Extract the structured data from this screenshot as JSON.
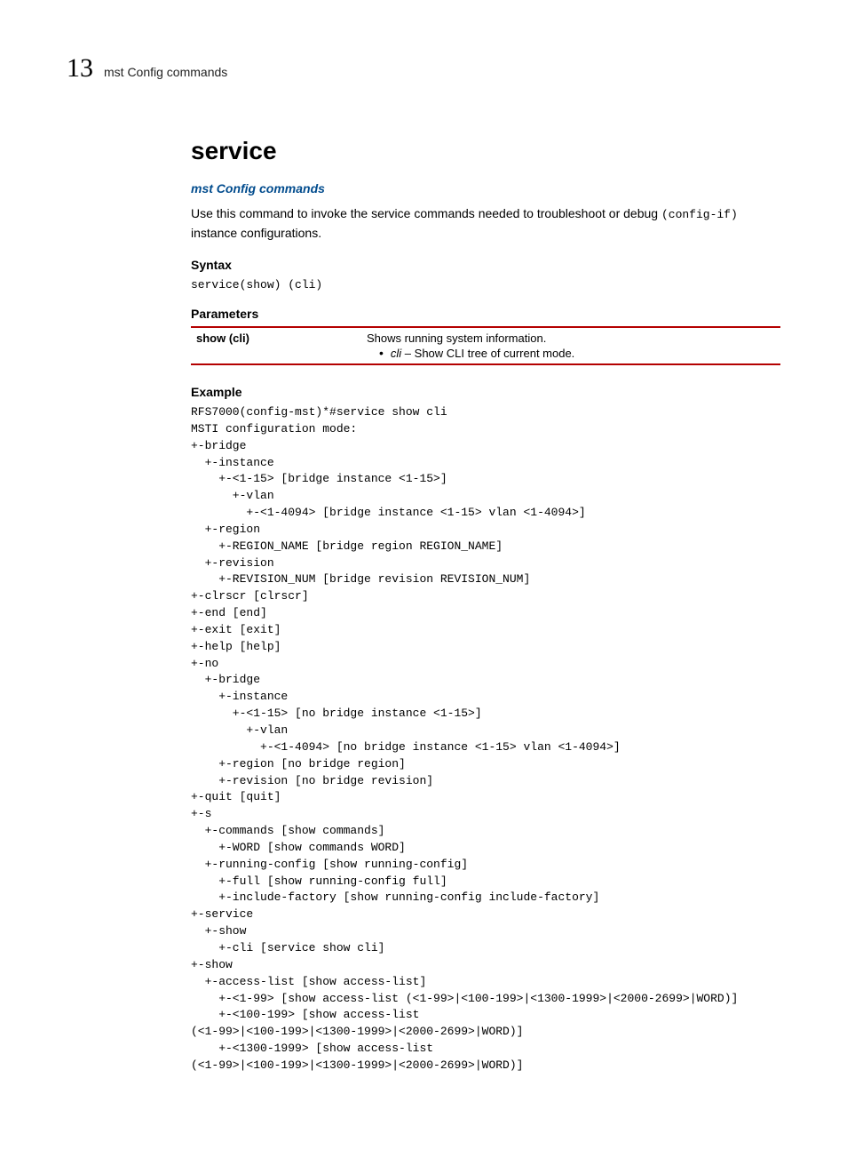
{
  "header": {
    "chapter_number": "13",
    "chapter_name": "mst Config commands"
  },
  "title": "service",
  "breadcrumb_link": "mst Config commands",
  "intro_before_code": "Use this command to invoke the service commands needed to troubleshoot or debug ",
  "intro_code": "(config-if)",
  "intro_after_code": " instance configurations.",
  "syntax": {
    "heading": "Syntax",
    "code": "service(show) (cli)"
  },
  "parameters": {
    "heading": "Parameters",
    "row": {
      "name": "show (cli)",
      "desc_line1": "Shows running system information.",
      "bullet_keyword": "cli",
      "bullet_sep": " – ",
      "bullet_text": "Show CLI tree of current mode."
    }
  },
  "example": {
    "heading": "Example",
    "code": "RFS7000(config-mst)*#service show cli\nMSTI configuration mode:\n+-bridge\n  +-instance\n    +-<1-15> [bridge instance <1-15>]\n      +-vlan\n        +-<1-4094> [bridge instance <1-15> vlan <1-4094>]\n  +-region\n    +-REGION_NAME [bridge region REGION_NAME]\n  +-revision\n    +-REVISION_NUM [bridge revision REVISION_NUM]\n+-clrscr [clrscr]\n+-end [end]\n+-exit [exit]\n+-help [help]\n+-no\n  +-bridge\n    +-instance\n      +-<1-15> [no bridge instance <1-15>]\n        +-vlan\n          +-<1-4094> [no bridge instance <1-15> vlan <1-4094>]\n    +-region [no bridge region]\n    +-revision [no bridge revision]\n+-quit [quit]\n+-s\n  +-commands [show commands]\n    +-WORD [show commands WORD]\n  +-running-config [show running-config]\n    +-full [show running-config full]\n    +-include-factory [show running-config include-factory]\n+-service\n  +-show\n    +-cli [service show cli]\n+-show\n  +-access-list [show access-list]\n    +-<1-99> [show access-list (<1-99>|<100-199>|<1300-1999>|<2000-2699>|WORD)]\n    +-<100-199> [show access-list \n(<1-99>|<100-199>|<1300-1999>|<2000-2699>|WORD)]\n    +-<1300-1999> [show access-list \n(<1-99>|<100-199>|<1300-1999>|<2000-2699>|WORD)]"
  }
}
